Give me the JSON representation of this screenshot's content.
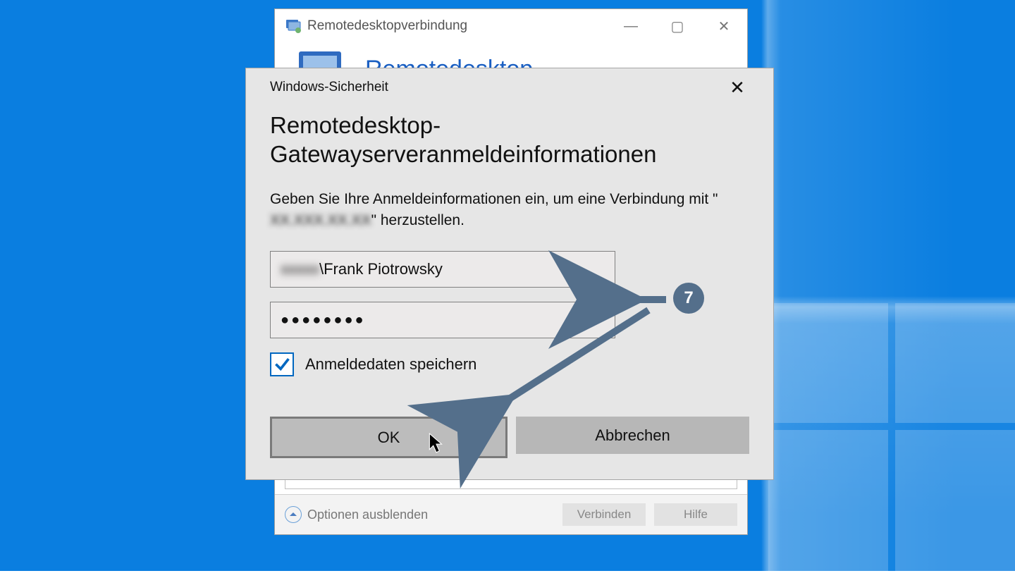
{
  "rdc": {
    "title": "Remotedesktopverbindung",
    "header": "Remotedesktop",
    "options_label": "Optionen ausblenden",
    "connect_label": "Verbinden",
    "help_label": "Hilfe"
  },
  "security_dialog": {
    "window_title": "Windows-Sicherheit",
    "heading": "Remotedesktop-Gatewayserveranmeldeinformationen",
    "prompt_prefix": "Geben Sie Ihre Anmeldeinformationen ein, um eine Verbindung mit \"",
    "server_blurred": "XX.XXX.XX.XX",
    "prompt_suffix": "\" herzustellen.",
    "username_domain_blurred": "xxxxx",
    "username_name": "\\Frank Piotrowsky",
    "password_mask": "●●●●●●●●",
    "remember_label": "Anmeldedaten speichern",
    "remember_checked": true,
    "ok_label": "OK",
    "cancel_label": "Abbrechen"
  },
  "annotation": {
    "step_number": "7",
    "color": "#546f8b"
  }
}
